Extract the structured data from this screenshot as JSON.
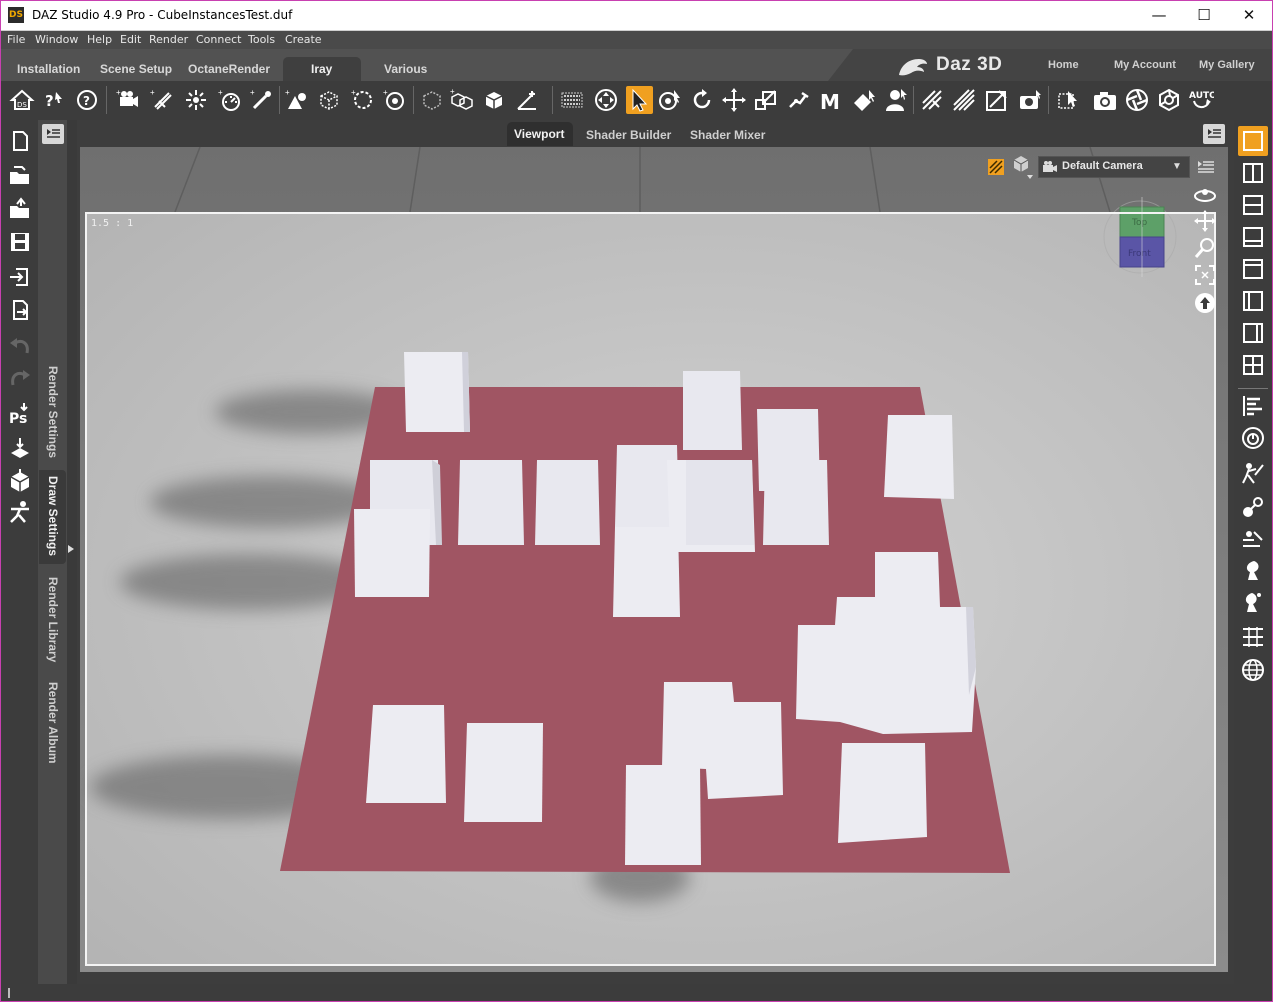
{
  "window": {
    "title": "DAZ Studio 4.9 Pro - CubeInstancesTest.duf",
    "app_icon_text": "DS",
    "minimize_glyph": "—",
    "maximize_glyph": "☐",
    "close_glyph": "✕"
  },
  "menu": {
    "items": [
      "File",
      "Window",
      "Help",
      "Edit",
      "Render",
      "Connect",
      "Tools",
      "Create"
    ]
  },
  "main_tabs": {
    "items": [
      "Installation",
      "Scene Setup",
      "OctaneRender",
      "Iray",
      "Various"
    ],
    "active": "Iray"
  },
  "brand": {
    "logo_text": "Daz 3D",
    "links": [
      "Home",
      "My Account",
      "My Gallery"
    ]
  },
  "viewport_tabs": {
    "items": [
      "Viewport",
      "Shader Builder",
      "Shader Mixer"
    ],
    "active": "Viewport"
  },
  "side_tabs": {
    "items": [
      "Render Settings",
      "Draw Settings",
      "Render Library",
      "Render Album"
    ],
    "active": "Draw Settings"
  },
  "viewport": {
    "camera": "Default Camera",
    "aspect_ratio_label": "1.5 : 1",
    "dropdown_arrow": "▼",
    "nav_cube_top": "Top",
    "nav_cube_front": "Front"
  },
  "toolbar": {
    "auto_label": "AUTO",
    "active_tool": "pointer-tool"
  },
  "colors": {
    "accent": "#f0a020",
    "floor_plane": "#a05563",
    "background_ground": "#c9c9c9"
  }
}
